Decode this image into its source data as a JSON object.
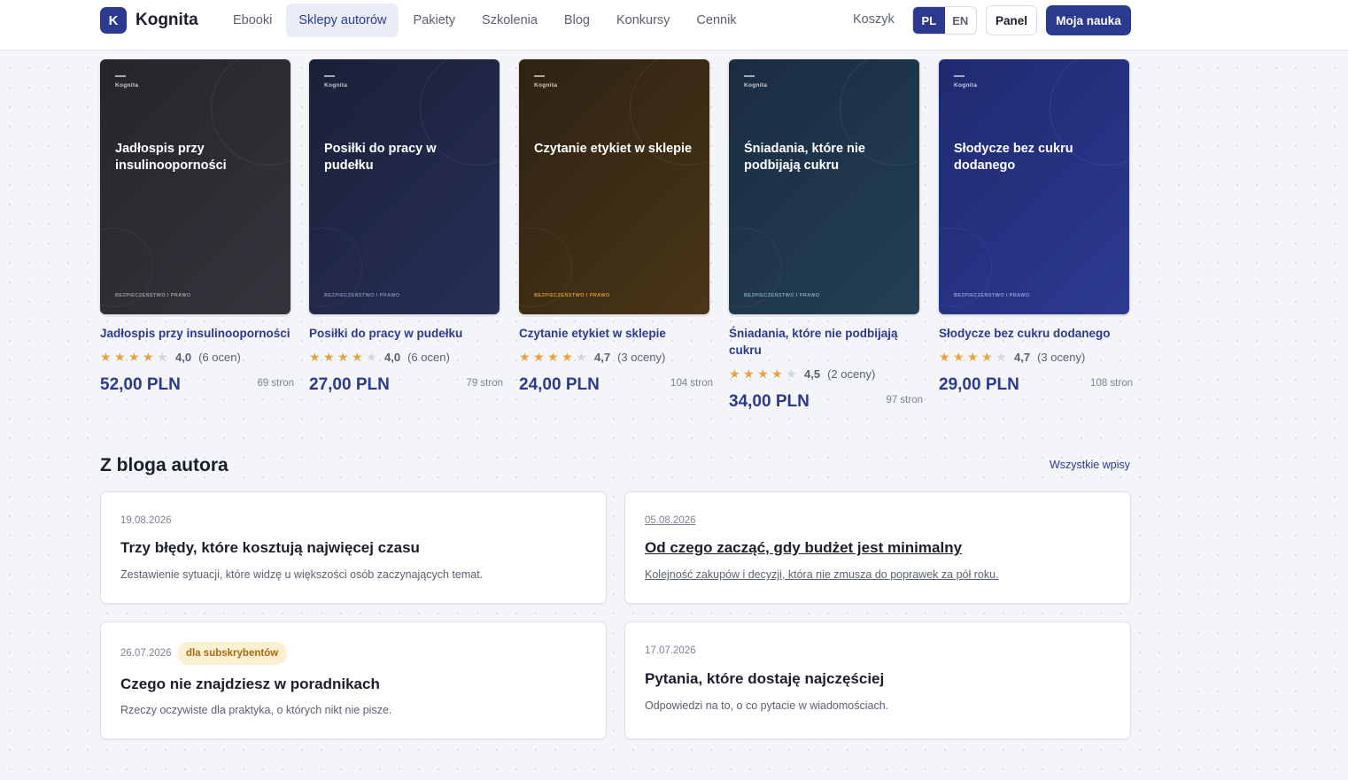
{
  "header": {
    "logo_letter": "K",
    "logo_text": "Kognita",
    "nav": [
      "Ebooki",
      "Sklepy autorów",
      "Pakiety",
      "Szkolenia",
      "Blog",
      "Konkursy",
      "Cennik"
    ],
    "cart": "Koszyk",
    "lang_pl": "PL",
    "lang_en": "EN",
    "panel": "Panel",
    "primary": "Moja nauka"
  },
  "books": [
    {
      "cover_title": "Jadłospis przy insulinooporności",
      "brand": "Kognita",
      "category": "BEZPIECZEŃSTWO I PRAWO",
      "title": "Jadłospis przy insulinooporności",
      "rating_value": "4,0",
      "rating": 4.0,
      "rating_count": "(6 ocen)",
      "price": "52,00 PLN",
      "pages": "69 stron",
      "bg1": "#25252b",
      "bg2": "#34343c",
      "cat_color": "#9a9aa6"
    },
    {
      "cover_title": "Posiłki do pracy w pudełku",
      "brand": "Kognita",
      "category": "BEZPIECZEŃSTWO I PRAWO",
      "title": "Posiłki do pracy w pudełku",
      "rating_value": "4,0",
      "rating": 4.0,
      "rating_count": "(6 ocen)",
      "price": "27,00 PLN",
      "pages": "79 stron",
      "bg1": "#1b2038",
      "bg2": "#262f57",
      "cat_color": "#7e88b8"
    },
    {
      "cover_title": "Czytanie etykiet w sklepie",
      "brand": "Kognita",
      "category": "BEZPIECZEŃSTWO I PRAWO",
      "title": "Czytanie etykiet w sklepie",
      "rating_value": "4,7",
      "rating": 4.7,
      "rating_count": "(3 oceny)",
      "price": "24,00 PLN",
      "pages": "104 stron",
      "bg1": "#2d2214",
      "bg2": "#4a3617",
      "cat_color": "#d19a3e"
    },
    {
      "cover_title": "Śniadania, które nie podbijają cukru",
      "brand": "Kognita",
      "category": "BEZPIECZEŃSTWO I PRAWO",
      "title": "Śniadania, które nie podbijają cukru",
      "rating_value": "4,5",
      "rating": 4.5,
      "rating_count": "(2 oceny)",
      "price": "34,00 PLN",
      "pages": "97 stron",
      "bg1": "#1a2c42",
      "bg2": "#243f55",
      "cat_color": "#7fa3be"
    },
    {
      "cover_title": "Słodycze bez cukru dodanego",
      "brand": "Kognita",
      "category": "BEZPIECZEŃSTWO I PRAWO",
      "title": "Słodycze bez cukru dodanego",
      "rating_value": "4,7",
      "rating": 4.7,
      "rating_count": "(3 oceny)",
      "price": "29,00 PLN",
      "pages": "108 stron",
      "bg1": "#1f2a70",
      "bg2": "#2c3a90",
      "cat_color": "#8f9ddc"
    }
  ],
  "blog": {
    "heading": "Z bloga autora",
    "all_link": "Wszystkie wpisy",
    "posts": [
      {
        "date": "19.08.2026",
        "title": "Trzy błędy, które kosztują najwięcej czasu",
        "desc": "Zestawienie sytuacji, które widzę u większości osób zaczynających temat.",
        "badge": ""
      },
      {
        "date": "05.08.2026",
        "title": "Od czego zacząć, gdy budżet jest minimalny",
        "desc": "Kolejność zakupów i decyzji, która nie zmusza do poprawek za pół roku.",
        "badge": ""
      },
      {
        "date": "26.07.2026",
        "title": "Czego nie znajdziesz w poradnikach",
        "desc": "Rzeczy oczywiste dla praktyka, o których nikt nie pisze.",
        "badge": "dla subskrybentów"
      },
      {
        "date": "17.07.2026",
        "title": "Pytania, które dostaję najczęściej",
        "desc": "Odpowiedzi na to, o co pytacie w wiadomościach.",
        "badge": ""
      }
    ]
  },
  "colors": {
    "accent": "#2b3a8f",
    "star": "#e8a23a",
    "badge_bg": "#fcefd2"
  }
}
